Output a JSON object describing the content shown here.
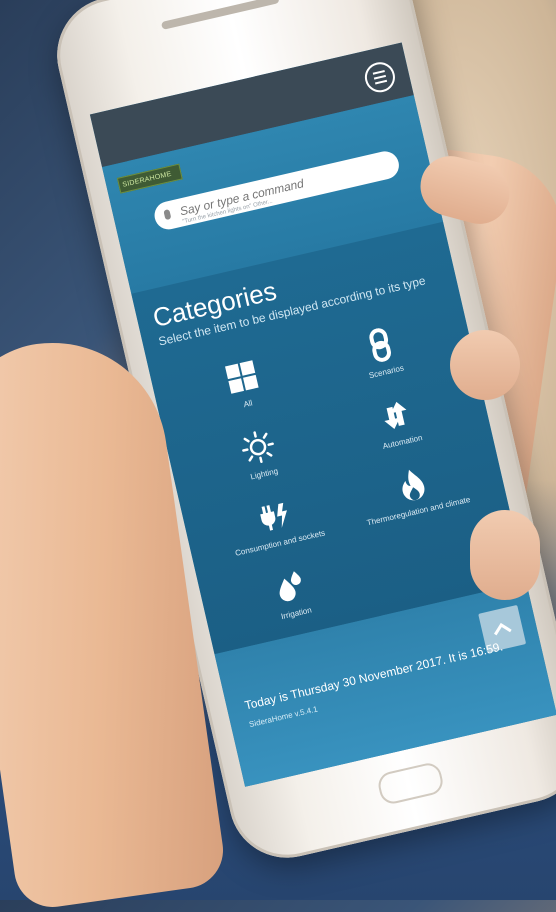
{
  "app": {
    "logo_text": "SIDERAHOME",
    "menu_icon": "hamburger-menu-icon"
  },
  "search": {
    "placeholder": "Say or type a command",
    "hint": "\"Turn the kitchen lights on\" Other...",
    "icon": "microphone-icon"
  },
  "categories": {
    "title": "Categories",
    "subtitle": "Select the item to be displayed according to its type",
    "items": [
      {
        "label": "All",
        "icon": "grid-windows-icon"
      },
      {
        "label": "Scenarios",
        "icon": "scenarios-link-icon"
      },
      {
        "label": "Lighting",
        "icon": "sun-icon"
      },
      {
        "label": "Automation",
        "icon": "up-down-arrows-icon"
      },
      {
        "label": "Consumption and sockets",
        "icon": "plug-lightning-icon"
      },
      {
        "label": "Thermoregulation and climate",
        "icon": "flame-icon"
      },
      {
        "label": "Irrigation",
        "icon": "water-drops-icon"
      }
    ]
  },
  "footer": {
    "date_text": "Today is Thursday 30 November 2017. It is 16:59.",
    "version": "SideraHome v.5.4.1",
    "scroll_top_icon": "chevron-up-icon"
  }
}
